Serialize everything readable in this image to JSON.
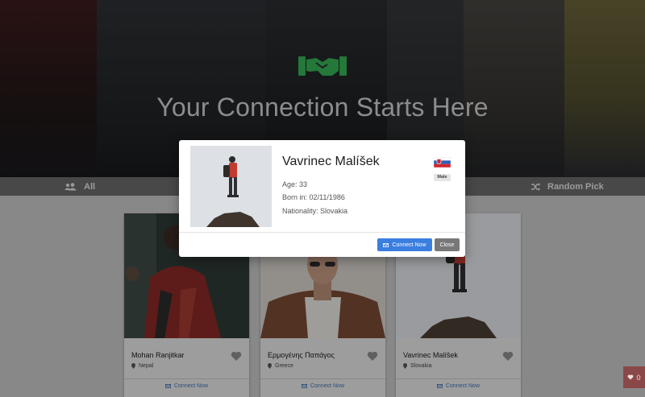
{
  "hero": {
    "title": "Your Connection Starts Here",
    "logo_icon": "handshake-icon",
    "accent_color": "#36b254"
  },
  "filters": {
    "all_label": "All",
    "all_icon": "users-icon",
    "random_label": "Random Pick",
    "random_icon": "shuffle-icon"
  },
  "cards": [
    {
      "name": "Mohan Ranjitkar",
      "location": "Nepal",
      "connect_label": "Connect Now"
    },
    {
      "name": "Ερμογένης Παπάγος",
      "location": "Greece",
      "connect_label": "Connect Now"
    },
    {
      "name": "Vavrinec Malíšek",
      "location": "Slovakia",
      "connect_label": "Connect Now"
    }
  ],
  "modal": {
    "name": "Vavrinec Malíšek",
    "age_line": "Age: 33",
    "born_line": "Born in: 02/11/1986",
    "nationality_line": "Nationality: Slovakia",
    "gender_badge": "Male",
    "flag_icon": "slovakia-flag-icon",
    "connect_label": "Connect Now",
    "close_label": "Close",
    "primary_color": "#3a7ee0"
  },
  "favorites": {
    "count": "0",
    "icon": "heart-icon"
  }
}
